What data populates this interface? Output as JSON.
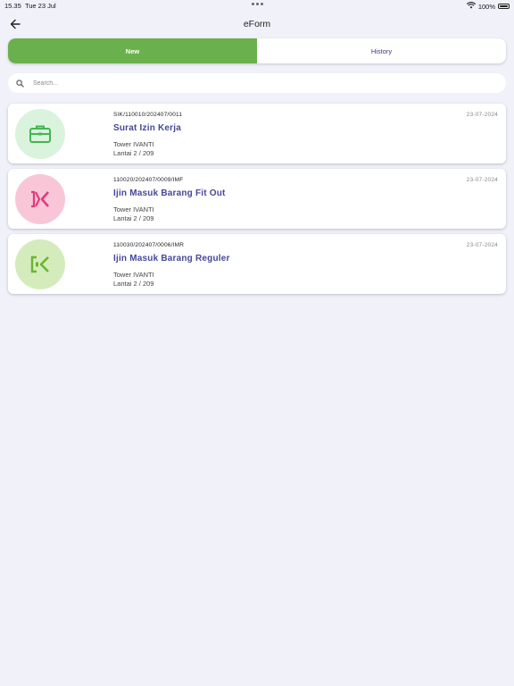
{
  "status_bar": {
    "time": "15.35",
    "date": "Tue 23 Jul",
    "battery": "100%"
  },
  "header": {
    "title": "eForm"
  },
  "tabs": [
    {
      "label": "New",
      "active": true
    },
    {
      "label": "History",
      "active": false
    }
  ],
  "search": {
    "placeholder": "Search..."
  },
  "colors": {
    "accent_green": "#6ab04c",
    "title_purple": "#46469a"
  },
  "items": [
    {
      "code": "SIK/110010/202407/0011",
      "date": "23-07-2024",
      "title": "Surat Izin Kerja",
      "location": "Tower IVANTI",
      "floor": "Lantai 2 / 209",
      "icon": "briefcase-icon",
      "icon_bg": "#d9f3dd",
      "icon_color": "#43b653"
    },
    {
      "code": "110020/202407/0009/IMF",
      "date": "23-07-2024",
      "title": "Ijin Masuk Barang Fit Out",
      "location": "Tower IVANTI",
      "floor": "Lantai 2 / 209",
      "icon": "entry-arrows-icon",
      "icon_bg": "#f9c6d8",
      "icon_color": "#e23a7a"
    },
    {
      "code": "110030/202407/0006/IMR",
      "date": "23-07-2024",
      "title": "Ijin Masuk Barang Reguler",
      "location": "Tower IVANTI",
      "floor": "Lantai 2 / 209",
      "icon": "login-arrow-icon",
      "icon_bg": "#d4ecbc",
      "icon_color": "#6ab52e"
    }
  ]
}
